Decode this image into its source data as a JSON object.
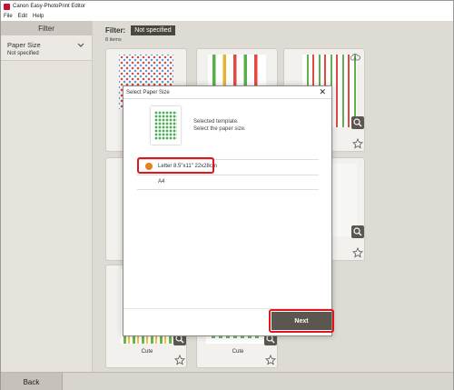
{
  "window": {
    "title": "Canon Easy-PhotoPrint Editor"
  },
  "menu": [
    "File",
    "Edit",
    "Help"
  ],
  "sidebar": {
    "header": "Filter",
    "paper_size_label": "Paper Size",
    "paper_size_value": "Not specified"
  },
  "main": {
    "filter_label": "Filter:",
    "filter_badge": "Not specified",
    "items_count": "8 items",
    "captions": [
      "Cute",
      "Cute"
    ]
  },
  "footer": {
    "back_label": "Back"
  },
  "dialog": {
    "title": "Select Paper Size",
    "message_line1": "Selected template.",
    "message_line2": "Select the paper size.",
    "options": [
      "Letter 8.5\"x11\" 22x28cm",
      "A4"
    ],
    "selected_index": 0,
    "next_label": "Next"
  },
  "colors": {
    "highlight": "#e0161b",
    "accent": "#e67e22",
    "button": "#5c5650"
  }
}
